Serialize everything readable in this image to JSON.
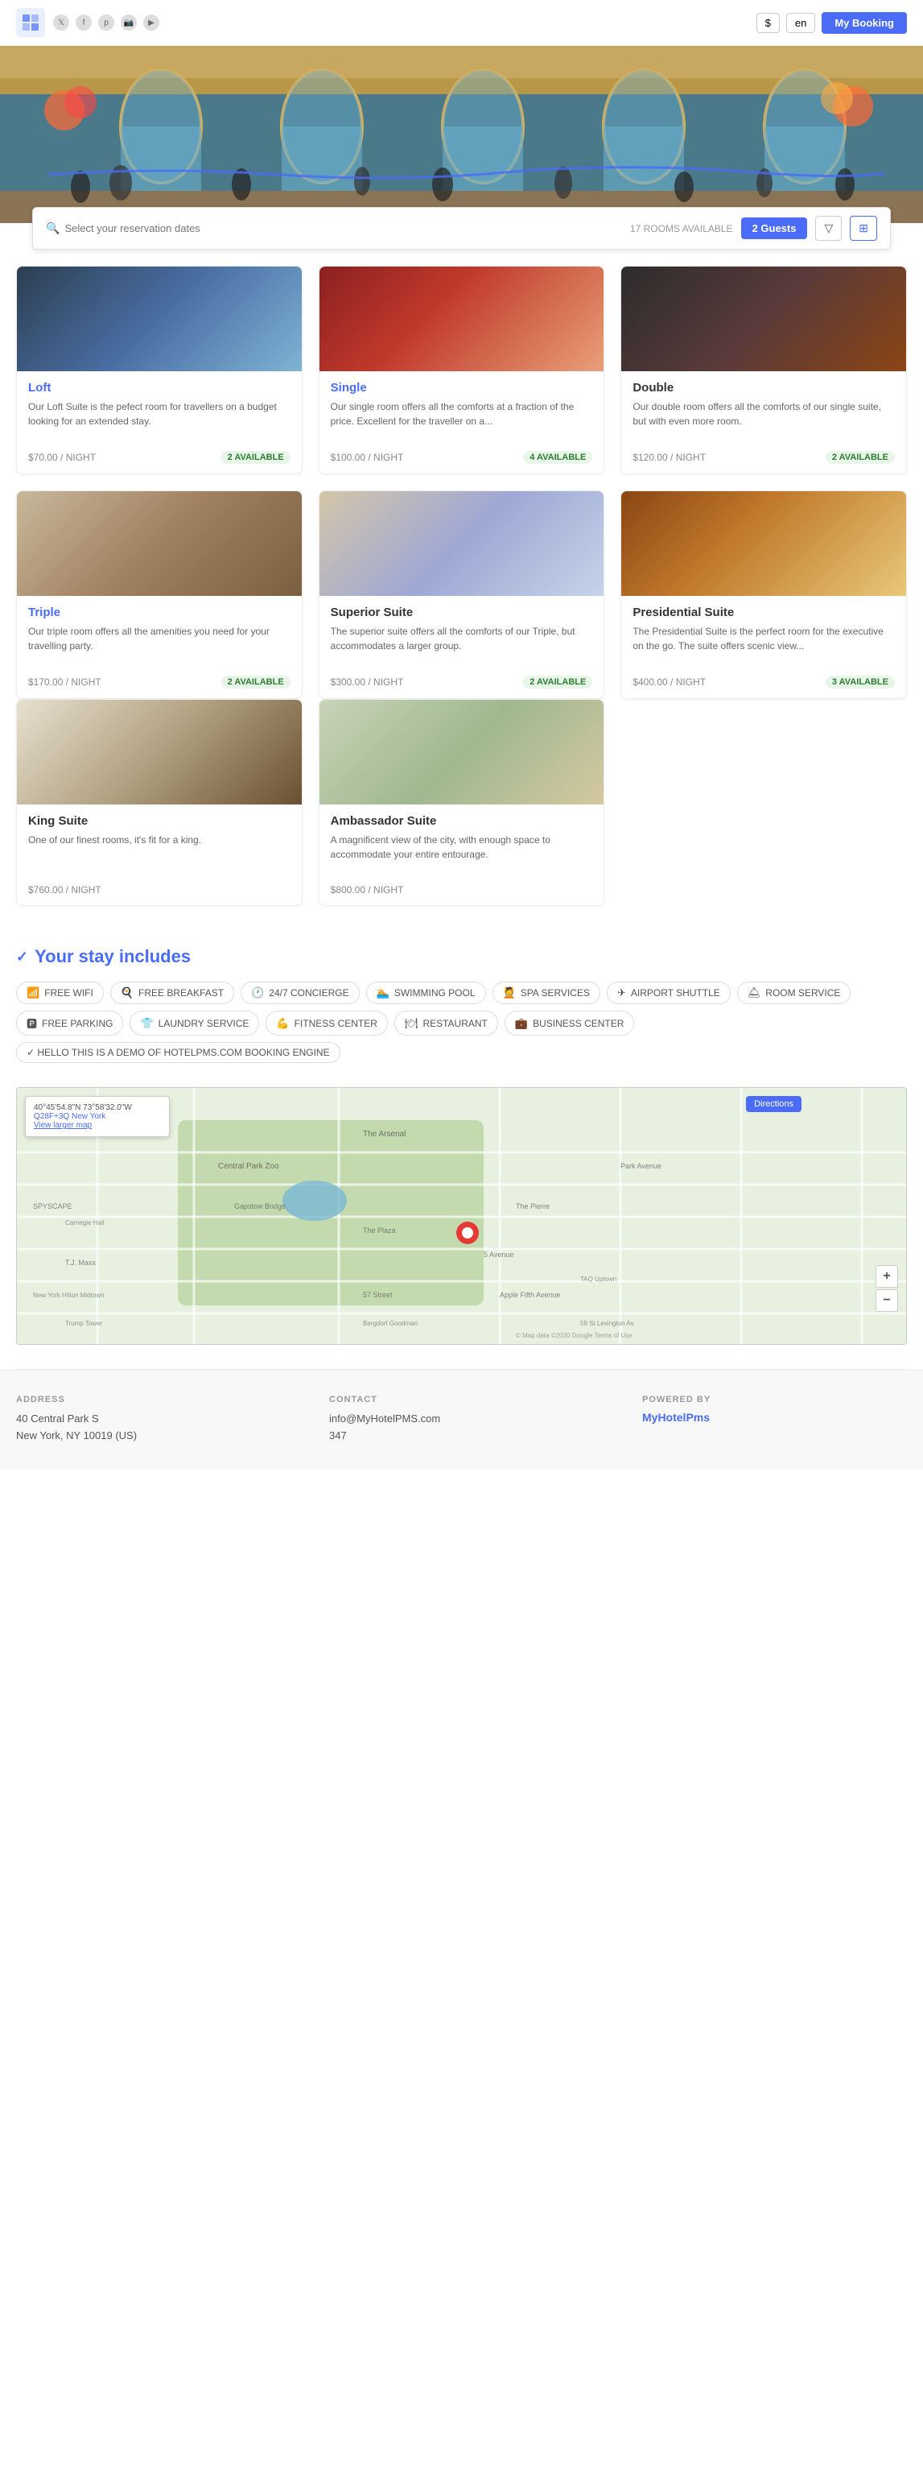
{
  "nav": {
    "currency": "$",
    "language": "en",
    "my_booking": "My Booking"
  },
  "search": {
    "placeholder": "Select your reservation dates",
    "rooms_available": "17 ROOMS AVAILABLE",
    "guests_label": "2 Guests"
  },
  "rooms": [
    {
      "id": "loft",
      "name": "Loft",
      "name_style": "blue",
      "description": "Our Loft Suite is the pefect room for travellers on a budget looking for an extended stay.",
      "price": "$70.00 / NIGHT",
      "available": "2 AVAILABLE",
      "img_class": "room-img-loft"
    },
    {
      "id": "single",
      "name": "Single",
      "name_style": "blue",
      "description": "Our single room offers all the comforts at a fraction of the price. Excellent for the traveller on a...",
      "price": "$100.00 / NIGHT",
      "available": "4 AVAILABLE",
      "img_class": "room-img-single"
    },
    {
      "id": "double",
      "name": "Double",
      "name_style": "dark",
      "description": "Our double room offers all the comforts of our single suite, but with even more room.",
      "price": "$120.00 / NIGHT",
      "available": "2 AVAILABLE",
      "img_class": "room-img-double"
    },
    {
      "id": "triple",
      "name": "Triple",
      "name_style": "blue",
      "description": "Our triple room offers all the amenities you need for your travelling party.",
      "price": "$170.00 / NIGHT",
      "available": "2 AVAILABLE",
      "img_class": "room-img-triple"
    },
    {
      "id": "superior-suite",
      "name": "Superior Suite",
      "name_style": "dark",
      "description": "The superior suite offers all the comforts of our Triple, but accommodates a larger group.",
      "price": "$300.00 / NIGHT",
      "available": "2 AVAILABLE",
      "img_class": "room-img-superior"
    },
    {
      "id": "presidential-suite",
      "name": "Presidential Suite",
      "name_style": "dark",
      "description": "The Presidential Suite is the perfect room for the executive on the go. The suite offers scenic view...",
      "price": "$400.00 / NIGHT",
      "available": "3 AVAILABLE",
      "img_class": "room-img-presidential"
    },
    {
      "id": "king-suite",
      "name": "King Suite",
      "name_style": "dark",
      "description": "One of our finest rooms, it's fit for a king.",
      "price": "$760.00 / NIGHT",
      "available": "",
      "img_class": "room-img-king"
    },
    {
      "id": "ambassador-suite",
      "name": "Ambassador Suite",
      "name_style": "dark",
      "description": "A magnificent view of the city, with enough space to accommodate your entire entourage.",
      "price": "$800.00 / NIGHT",
      "available": "",
      "img_class": "room-img-ambassador"
    }
  ],
  "stay_includes": {
    "title": "Your stay includes",
    "amenities": [
      {
        "icon": "📶",
        "label": "FREE WIFI"
      },
      {
        "icon": "🍳",
        "label": "FREE BREAKFAST"
      },
      {
        "icon": "🕐",
        "label": "24/7 CONCIERGE"
      },
      {
        "icon": "🏊",
        "label": "SWIMMING POOL"
      },
      {
        "icon": "💆",
        "label": "SPA SERVICES"
      },
      {
        "icon": "✈",
        "label": "AIRPORT SHUTTLE"
      },
      {
        "icon": "🛎",
        "label": "ROOM SERVICE"
      },
      {
        "icon": "🅿",
        "label": "FREE PARKING"
      },
      {
        "icon": "👕",
        "label": "LAUNDRY SERVICE"
      },
      {
        "icon": "💪",
        "label": "FITNESS CENTER"
      },
      {
        "icon": "🍽",
        "label": "RESTAURANT"
      },
      {
        "icon": "💼",
        "label": "BUSINESS CENTER"
      }
    ],
    "demo_text": "✓ HELLO THIS IS A DEMO OF HOTELPMS.COM BOOKING ENGINE"
  },
  "map": {
    "coords": "40°45'54.8\"N 73°58'32.0\"W",
    "plus_code": "Q28F+3Q New York",
    "view_larger": "View larger map",
    "directions": "Directions",
    "zoom_in": "+",
    "zoom_out": "−"
  },
  "footer": {
    "address_label": "ADDRESS",
    "address_line1": "40 Central Park S",
    "address_line2": "New York, NY 10019 (US)",
    "contact_label": "CONTACT",
    "contact_email": "info@MyHotelPMS.com",
    "contact_phone": "347",
    "powered_label": "POWERED BY",
    "powered_link": "MyHotelPms"
  }
}
